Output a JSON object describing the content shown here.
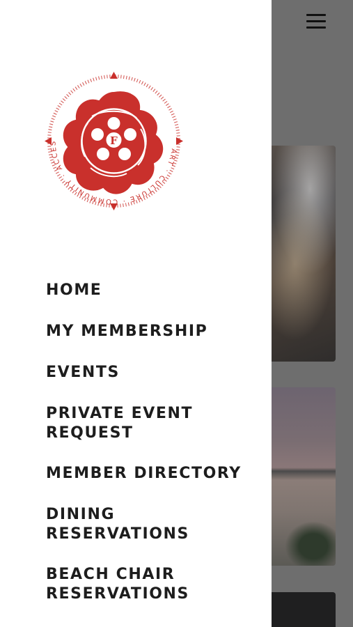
{
  "colors": {
    "brand_red": "#c9302c",
    "overlay_gray": "#6e6e6e",
    "menu_text": "#1d1d1d",
    "drawer_bg": "#ffffff"
  },
  "header": {
    "menu_icon": "hamburger-icon"
  },
  "logo": {
    "center_letter": "F",
    "ring_text": "ART · CULTURE · COMMUNITY · ACCESS"
  },
  "nav": {
    "items": [
      {
        "label": "HOME"
      },
      {
        "label": "MY MEMBERSHIP"
      },
      {
        "label": "EVENTS"
      },
      {
        "label": "PRIVATE EVENT\nREQUEST"
      },
      {
        "label": "MEMBER DIRECTORY"
      },
      {
        "label": "DINING\nRESERVATIONS"
      },
      {
        "label": "BEACH CHAIR\nRESERVATIONS"
      }
    ]
  }
}
